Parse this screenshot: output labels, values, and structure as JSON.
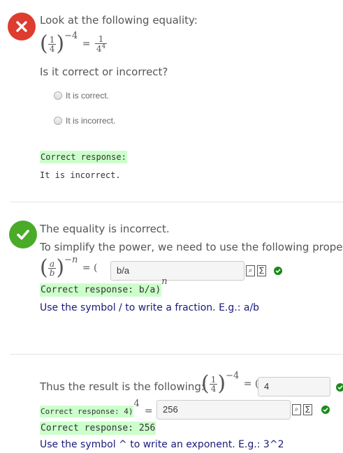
{
  "q1": {
    "prompt": "Look at the following equality:",
    "expr": {
      "base_num": "1",
      "base_den": "4",
      "exponent": "−4",
      "rhs_num": "1",
      "rhs_den_base": "4",
      "rhs_den_exp": "4"
    },
    "question": "Is it correct or incorrect?",
    "options": [
      "It is correct.",
      "It is incorrect."
    ],
    "correct_label": "Correct response:",
    "correct_value": "It is incorrect."
  },
  "q2": {
    "line1": "The equality is incorrect.",
    "line2": "To simplify the power, we need to use the following property",
    "formula": {
      "num": "a",
      "den": "b",
      "exponent": "−n",
      "eq": "= (",
      "exp_after": "n"
    },
    "input_value": "b/a",
    "correct_response": "Correct response: b/a)",
    "hint": "Use the symbol / to write a fraction. E.g.: a/b"
  },
  "q3": {
    "lead": "Thus the result is the following:",
    "expr": {
      "num": "1",
      "den": "4",
      "exponent": "−4",
      "eq": "= ("
    },
    "input1_value": "4",
    "correct1": "Correct response: 4)",
    "exp_after": "4",
    "eq2": "=",
    "input2_value": "256",
    "correct2": "Correct response: 256",
    "hint": "Use the symbol ^ to write an exponent. E.g.: 3^2"
  },
  "colors": {
    "wrong": "#dd3c2e",
    "right": "#4aab29",
    "highlight": "#ccffcc",
    "hint": "#1a1a7a"
  }
}
